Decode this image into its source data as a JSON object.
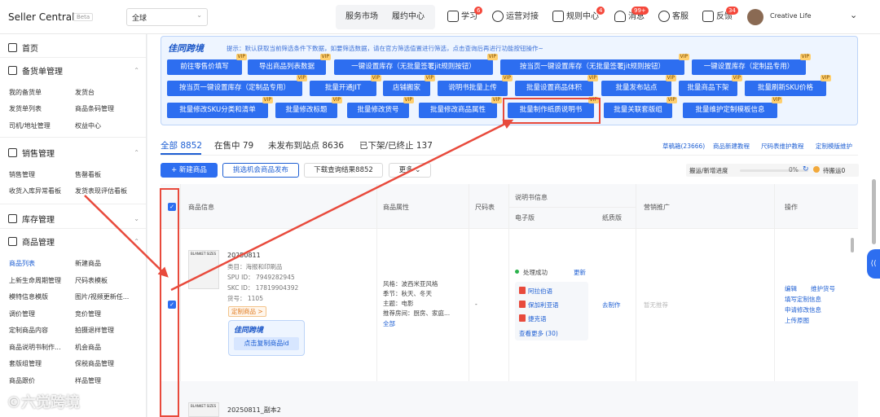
{
  "topbar": {
    "brand": "Seller Central",
    "beta": "Beta",
    "region": "全球",
    "nav": [
      {
        "label": "服务市场"
      },
      {
        "label": "履约中心"
      },
      {
        "label": "学习",
        "badge": "6"
      },
      {
        "label": "运营对接"
      },
      {
        "label": "规则中心",
        "badge": "4"
      },
      {
        "label": "消息",
        "badge": "99+"
      },
      {
        "label": "客服"
      },
      {
        "label": "反馈",
        "badge": "34"
      }
    ],
    "user": "Creative Life"
  },
  "sidebar": {
    "home": "首页",
    "sections": [
      {
        "title": "备货单管理",
        "items": [
          "我的备货单",
          "发货台",
          "发货单列表",
          "商品条码管理",
          "司机/地址管理",
          "权益中心"
        ]
      },
      {
        "title": "销售管理",
        "items": [
          "销售管理",
          "售罄看板",
          "收货入库异常看板",
          "发货表现评估看板"
        ]
      },
      {
        "title": "库存管理",
        "items": []
      },
      {
        "title": "商品管理",
        "items": [
          "商品列表",
          "新建商品",
          "上新生命周期管理",
          "尺码表模板",
          "模特信息模版",
          "图片/视频更新任...",
          "调价管理",
          "竞价管理",
          "定制商品内容",
          "拍摄退样管理",
          "商品说明书制作...",
          "机会商品",
          "套版组管理",
          "保税商品管理",
          "商品跟价",
          "样品管理"
        ]
      }
    ]
  },
  "toolpanel": {
    "logo": "佳同跨境",
    "tip": "提示：默认获取当前筛选条件下数据，如要筛选数据，请在官方筛选值置进行筛选，点击查询后再进行功能按钮操作~",
    "vip": "VIP",
    "buttons": [
      "前往零售价填写",
      "导出商品列表数据",
      "一键设置库存（无批量签署jit规则按钮）",
      "按当页一键设置库存（无批量签署jit规则按钮）",
      "一键设置库存（定制品专用）",
      "按当页一键设置库存（定制品专用）",
      "批量开通JIT",
      "店铺搬家",
      "说明书批量上传",
      "批量设置商品体积",
      "批量发布站点",
      "批量商品下架",
      "批量刷新SKU价格",
      "批量修改SKU分类和清单",
      "批量修改标题",
      "批量修改货号",
      "批量修改商品属性",
      "批量制作纸质说明书",
      "批量关联套版组",
      "批量维护定制模板信息"
    ]
  },
  "tabs": {
    "items": [
      "全部 8852",
      "在售中 79",
      "未发布到站点 8636",
      "已下架/已终止 137"
    ],
    "right_links": [
      "草稿箱(23666)",
      "商品新建教程",
      "尺码表维护教程",
      "定制模版维护"
    ]
  },
  "actions": {
    "new": "+ 新建商品",
    "pick": "挑选机会商品发布",
    "download": "下载查询结果8852",
    "more": "更多 ⌄",
    "progress_label": "搬运/新增进度",
    "progress_pct": "0%",
    "pending": "待搬运0",
    "progress_value": 0
  },
  "table": {
    "headers": {
      "info": "商品信息",
      "attr": "商品属性",
      "size": "尺码表",
      "manual": "说明书信息",
      "electronic": "电子版",
      "paper": "纸质版",
      "promo": "营销推广",
      "op": "操作"
    },
    "row1": {
      "name": "20250811",
      "category": "类目：海报和印刷品",
      "spu": "SPU ID： 7949282945",
      "skc": "SKC ID： 17819904392",
      "sku_no": "货号： 1105",
      "tag": "定制商品 >",
      "attrs": [
        "风格：波西米亚风格",
        "季节：秋天、冬天",
        "主题：电影",
        "推荐房间：厨房、家庭..."
      ],
      "attr_all": "全部",
      "size": "-",
      "status": "处理成功",
      "update": "更新",
      "docs": [
        "阿拉伯语",
        "保加利亚语",
        "捷克语"
      ],
      "docs_more": "查看更多 (30)",
      "paper": "去制作",
      "promo": "暂无推荐",
      "ops": [
        "编辑",
        "维护货号",
        "填写定制信息",
        "申请修改信息",
        "上传原图"
      ],
      "copy_logo": "佳同跨境",
      "copy_btn": "点击复制商品id",
      "thumb_label": "BLANKET SIZES"
    },
    "row2": {
      "name": "20250811_副本2",
      "thumb_label": "BLANKET SIZES"
    }
  },
  "watermark": "©六觉跨境",
  "colors": {
    "primary": "#2d6ef0",
    "annotation": "#e84a3c",
    "badge": "#f5483b"
  }
}
